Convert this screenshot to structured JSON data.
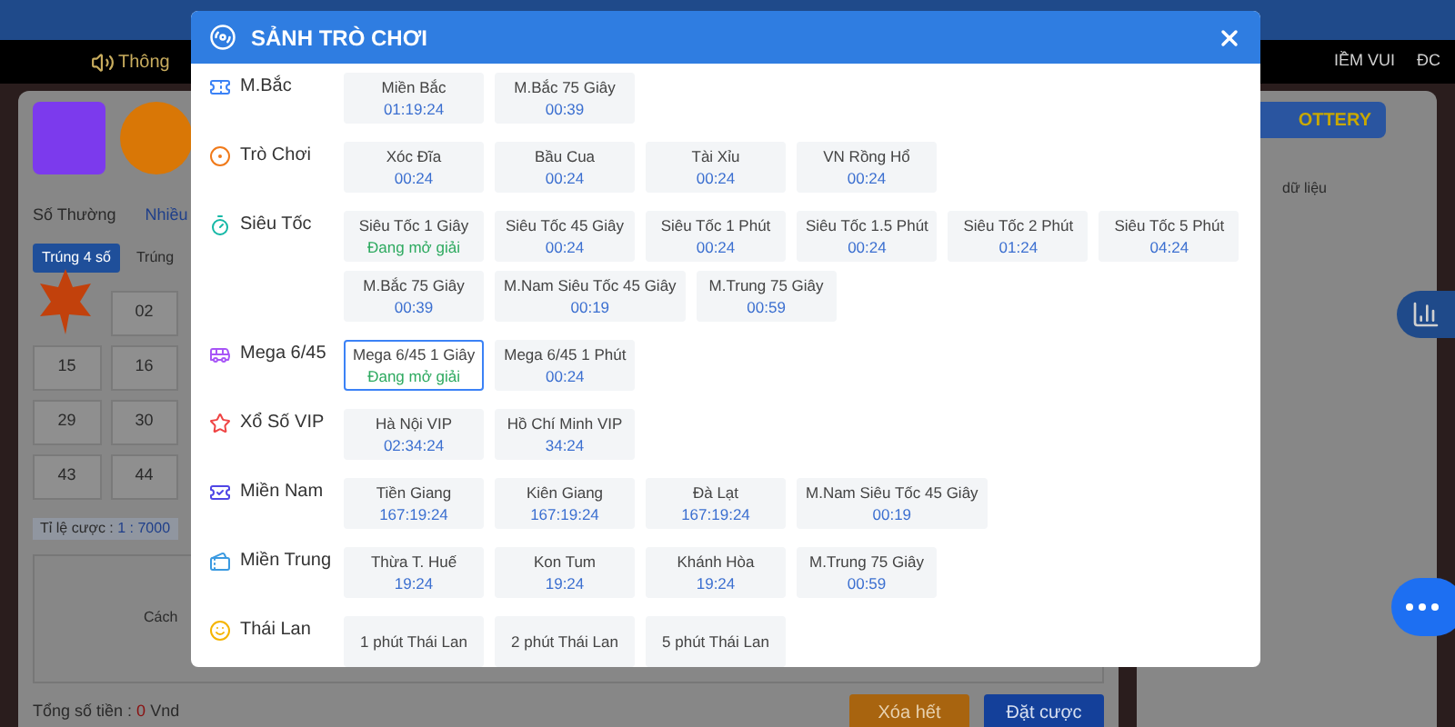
{
  "announcement": {
    "text": "Thông",
    "right_items": [
      "IỀM VUI",
      "ĐC"
    ]
  },
  "left_panel": {
    "tabs": [
      {
        "label": "Số Thường",
        "selected": true
      },
      {
        "label": "Nhiều",
        "selected": false
      }
    ],
    "sub_tabs": [
      {
        "label": "Trúng 4 số",
        "selected": true
      },
      {
        "label": "Trúng",
        "selected": false
      }
    ],
    "numbers": [
      "02",
      "15",
      "16",
      "29",
      "30",
      "43",
      "44"
    ],
    "odds_label": "Tỉ lệ cược : ",
    "odds_value": "1 : 7000",
    "howto": "Cách",
    "total_label": "Tổng số tiền : ",
    "total_value": "0",
    "total_unit": " Vnd",
    "buttons": [
      {
        "label": "Xóa hết",
        "kind": "clear"
      },
      {
        "label": "Đặt cược",
        "kind": "bet"
      }
    ]
  },
  "right_panel": {
    "banner": "OTTERY",
    "text": "dữ liệu"
  },
  "dialog": {
    "title": "SẢNH TRÒ CHƠI",
    "categories": [
      {
        "label": "M.Bắc",
        "rows": [
          [
            {
              "name": "Miền Bắc",
              "status": "01:19:24",
              "kind": "time",
              "selected": false
            },
            {
              "name": "M.Bắc 75 Giây",
              "status": "00:39",
              "kind": "time",
              "selected": false
            }
          ]
        ]
      },
      {
        "label": "Trò Chơi",
        "rows": [
          [
            {
              "name": "Xóc Đĩa",
              "status": "00:24",
              "kind": "time",
              "selected": false
            },
            {
              "name": "Bầu Cua",
              "status": "00:24",
              "kind": "time",
              "selected": false
            },
            {
              "name": "Tài Xỉu",
              "status": "00:24",
              "kind": "time",
              "selected": false
            },
            {
              "name": "VN Rồng Hổ",
              "status": "00:24",
              "kind": "time",
              "selected": false
            }
          ]
        ]
      },
      {
        "label": "Siêu Tốc",
        "rows": [
          [
            {
              "name": "Siêu Tốc 1 Giây",
              "status": "Đang mở giải",
              "kind": "open",
              "selected": false
            },
            {
              "name": "Siêu Tốc 45 Giây",
              "status": "00:24",
              "kind": "time",
              "selected": false
            },
            {
              "name": "Siêu Tốc 1 Phút",
              "status": "00:24",
              "kind": "time",
              "selected": false
            },
            {
              "name": "Siêu Tốc 1.5 Phút",
              "status": "00:24",
              "kind": "time",
              "selected": false
            },
            {
              "name": "Siêu Tốc 2 Phút",
              "status": "01:24",
              "kind": "time",
              "selected": false
            },
            {
              "name": "Siêu Tốc 5 Phút",
              "status": "04:24",
              "kind": "time",
              "selected": false
            }
          ],
          [
            {
              "name": "M.Bắc 75 Giây",
              "status": "00:39",
              "kind": "time",
              "selected": false
            },
            {
              "name": "M.Nam Siêu Tốc 45 Giây",
              "status": "00:19",
              "kind": "time",
              "selected": false
            },
            {
              "name": "M.Trung 75 Giây",
              "status": "00:59",
              "kind": "time",
              "selected": false
            }
          ]
        ]
      },
      {
        "label": "Mega 6/45",
        "rows": [
          [
            {
              "name": "Mega 6/45 1 Giây",
              "status": "Đang mở giải",
              "kind": "open",
              "selected": true
            },
            {
              "name": "Mega 6/45 1 Phút",
              "status": "00:24",
              "kind": "time",
              "selected": false
            }
          ]
        ]
      },
      {
        "label": "Xổ Số VIP",
        "rows": [
          [
            {
              "name": "Hà Nội VIP",
              "status": "02:34:24",
              "kind": "time",
              "selected": false
            },
            {
              "name": "Hồ Chí Minh VIP",
              "status": "34:24",
              "kind": "time",
              "selected": false
            }
          ]
        ]
      },
      {
        "label": "Miền Nam",
        "rows": [
          [
            {
              "name": "Tiền Giang",
              "status": "167:19:24",
              "kind": "time",
              "selected": false
            },
            {
              "name": "Kiên Giang",
              "status": "167:19:24",
              "kind": "time",
              "selected": false
            },
            {
              "name": "Đà Lạt",
              "status": "167:19:24",
              "kind": "time",
              "selected": false
            },
            {
              "name": "M.Nam Siêu Tốc 45 Giây",
              "status": "00:19",
              "kind": "time",
              "selected": false
            }
          ]
        ]
      },
      {
        "label": "Miền Trung",
        "rows": [
          [
            {
              "name": "Thừa T. Huế",
              "status": "19:24",
              "kind": "time",
              "selected": false
            },
            {
              "name": "Kon Tum",
              "status": "19:24",
              "kind": "time",
              "selected": false
            },
            {
              "name": "Khánh Hòa",
              "status": "19:24",
              "kind": "time",
              "selected": false
            },
            {
              "name": "M.Trung 75 Giây",
              "status": "00:59",
              "kind": "time",
              "selected": false
            }
          ]
        ]
      },
      {
        "label": "Thái Lan",
        "rows": [
          [
            {
              "name": "1 phút Thái Lan",
              "selected": false
            },
            {
              "name": "2 phút Thái Lan",
              "selected": false
            },
            {
              "name": "5 phút Thái Lan",
              "selected": false
            }
          ]
        ]
      }
    ]
  }
}
